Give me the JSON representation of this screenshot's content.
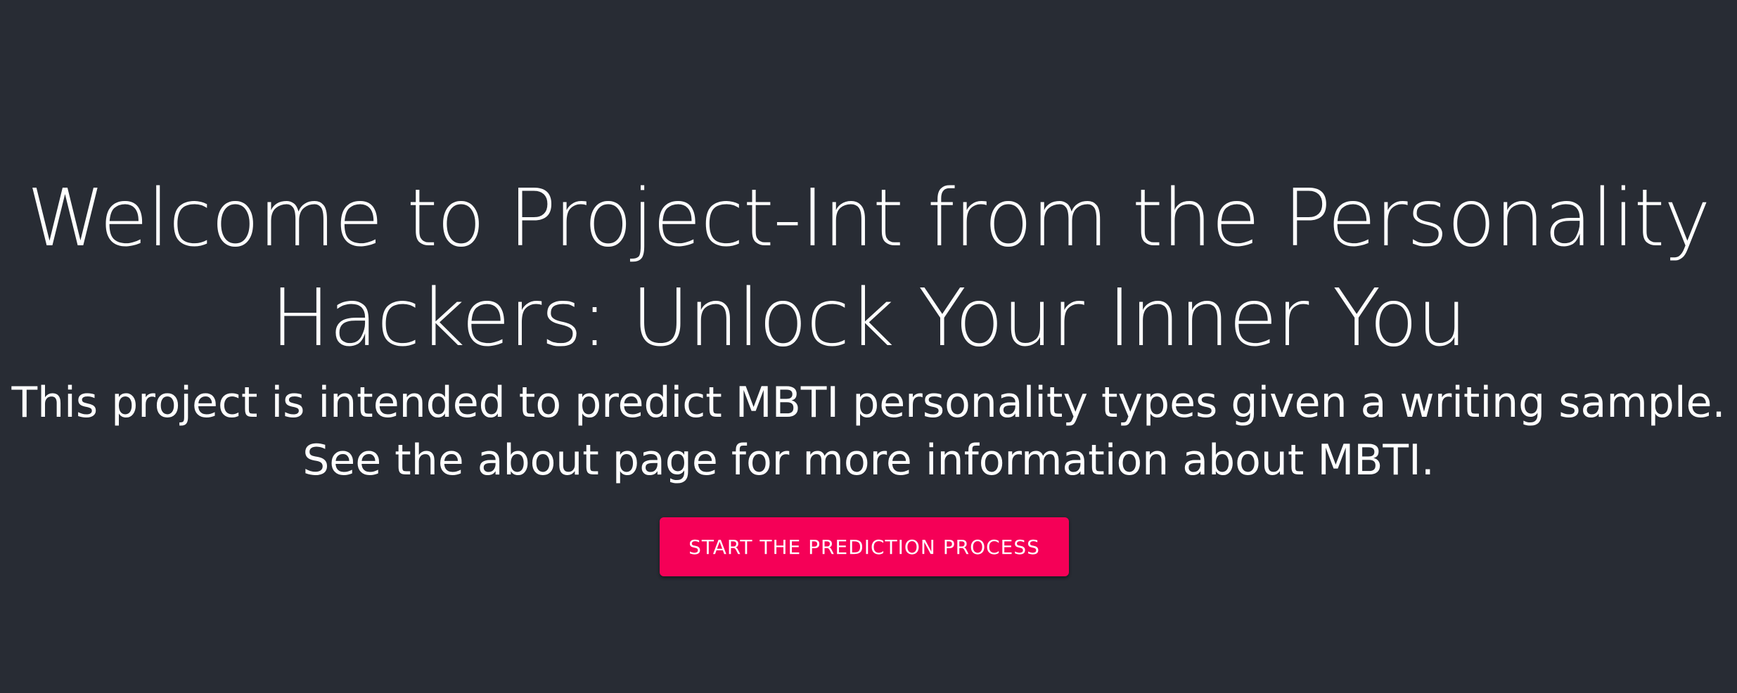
{
  "hero": {
    "title_line_1": "Welcome to Project-Int from the Personality",
    "title_line_2": "Hackers: Unlock Your Inner You",
    "subtitle_line_1": "This project is intended to predict MBTI personality types given a writing sample.",
    "subtitle_line_2": "See the about page for more information about MBTI.",
    "cta_label": "Start the Prediction Process"
  },
  "colors": {
    "background": "#282c34",
    "text": "#ffffff",
    "accent": "#f50057"
  }
}
